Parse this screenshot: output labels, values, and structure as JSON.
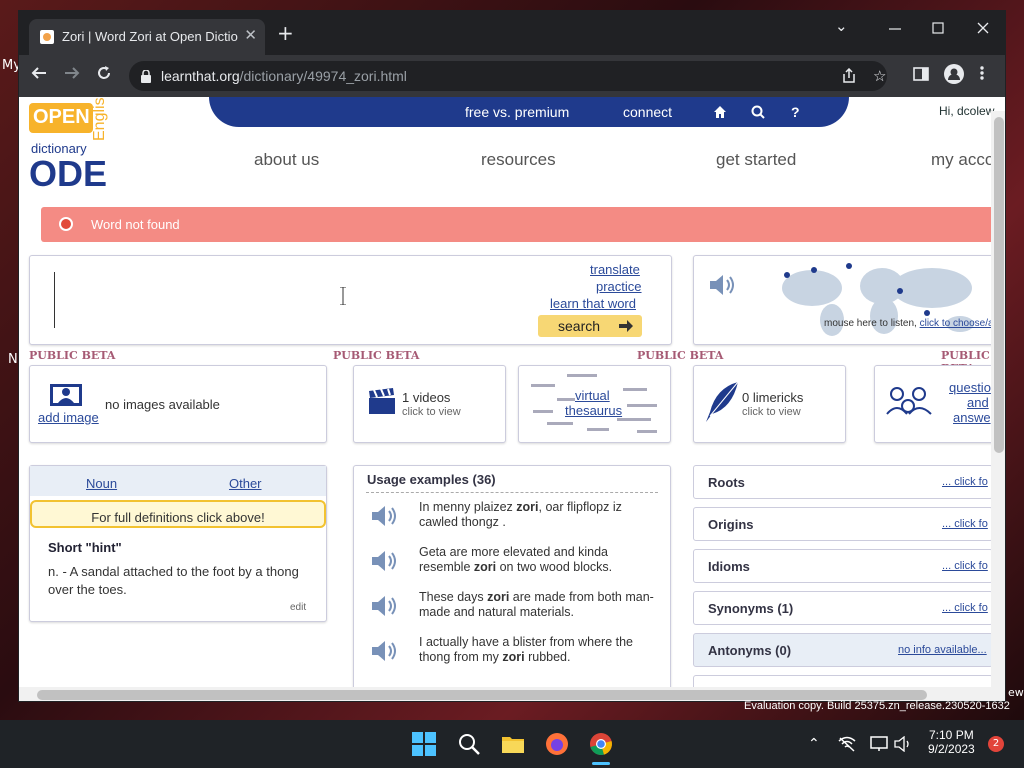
{
  "desktop": {
    "left_labels": [
      "My",
      "N"
    ],
    "right_label": "ew",
    "evaluation": "Evaluation copy. Build 25375.zn_release.230520-1632"
  },
  "browser": {
    "tab_title": "Zori | Word Zori at Open Dictionary",
    "url_host": "learnthat.org",
    "url_path": "/dictionary/49974_zori.html"
  },
  "site": {
    "topbar": {
      "free_vs_premium": "free vs. premium",
      "connect": "connect",
      "greeting": "Hi, dcolew"
    },
    "logo": {
      "open": "OPEN",
      "english": "English",
      "dictionary": "dictionary",
      "ode": "ODE"
    },
    "nav": [
      "about us",
      "resources",
      "get started",
      "my acco"
    ],
    "alert": "Word not found",
    "search": {
      "translate": "translate",
      "practice": "practice",
      "learn": "learn that word",
      "button": "search"
    },
    "listen": {
      "text": "mouse here to listen,",
      "link": "click to choose/add"
    },
    "beta": "PUBLIC BETA",
    "images": {
      "add": "add image",
      "none": "no images available"
    },
    "videos": {
      "count": "1 videos",
      "sub": "click to view"
    },
    "thesaurus": {
      "line1": "virtual",
      "line2": "thesaurus"
    },
    "limericks": {
      "count": "0 limericks",
      "sub": "click to view"
    },
    "qa": {
      "l1": "questio",
      "l2": "and",
      "l3": "answe"
    },
    "defs": {
      "noun": "Noun",
      "other": "Other",
      "full": "For full definitions click above!",
      "hint_title": "Short \"hint\"",
      "hint_body": "n. - A sandal attached to the foot by a thong over the toes.",
      "edit": "edit"
    },
    "usage": {
      "title": "Usage examples (36)",
      "items": [
        {
          "pre": "In menny plaizez ",
          "bold": "zori",
          "post": ", oar flipflopz iz cawled thongz ."
        },
        {
          "pre": "Geta are more elevated and kinda resemble ",
          "bold": "zori",
          "post": " on two wood blocks."
        },
        {
          "pre": "These days ",
          "bold": "zori",
          "post": " are made from both man-made and natural materials."
        },
        {
          "pre": "I actually have a blister from where the thong from my ",
          "bold": "zori",
          "post": " rubbed."
        }
      ]
    },
    "sections": [
      {
        "label": "Roots",
        "link": "... click fo"
      },
      {
        "label": "Origins",
        "link": "... click fo"
      },
      {
        "label": "Idioms",
        "link": "... click fo"
      },
      {
        "label": "Synonyms (1)",
        "link": "... click fo"
      },
      {
        "label": "Antonyms (0)",
        "link": "no info available..."
      }
    ]
  },
  "taskbar": {
    "time": "7:10 PM",
    "date": "9/2/2023",
    "notifications": "2"
  },
  "colors": {
    "brand_blue": "#1f3a8c",
    "alert": "#f48b84",
    "search_btn": "#f7d774",
    "beta": "#a65a74"
  }
}
